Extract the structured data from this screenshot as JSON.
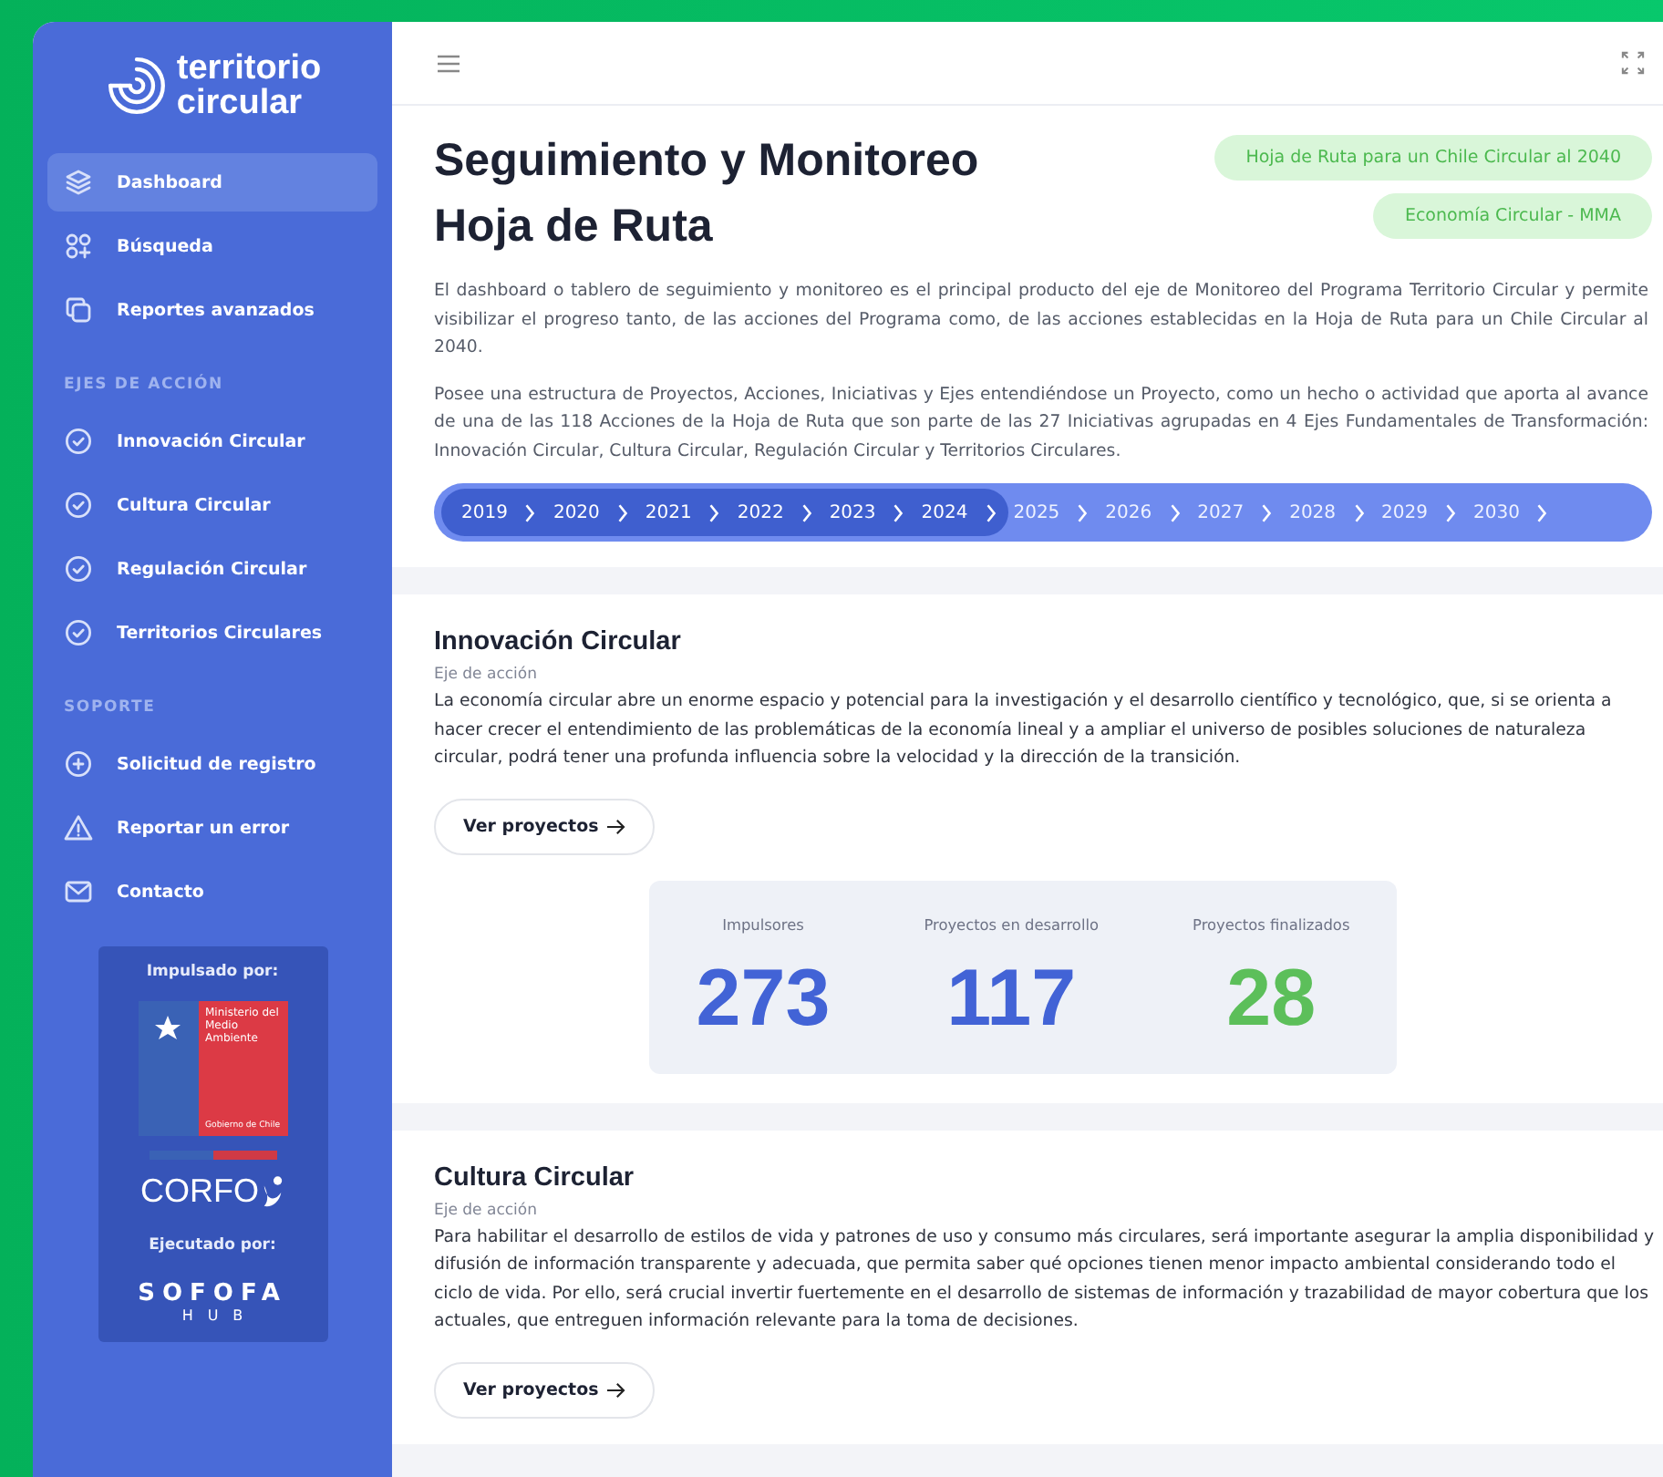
{
  "sidebar": {
    "logo": {
      "line1": "territorio",
      "line2": "circular"
    },
    "nav": [
      {
        "label": "Dashboard",
        "selected": true
      },
      {
        "label": "Búsqueda",
        "selected": false
      },
      {
        "label": "Reportes avanzados",
        "selected": false
      }
    ],
    "sections": [
      {
        "heading": "EJES DE ACCIÓN",
        "items": [
          {
            "label": "Innovación Circular"
          },
          {
            "label": "Cultura Circular"
          },
          {
            "label": "Regulación Circular"
          },
          {
            "label": "Territorios Circulares"
          }
        ]
      },
      {
        "heading": "SOPORTE",
        "items": [
          {
            "label": "Solicitud de registro"
          },
          {
            "label": "Reportar un error"
          },
          {
            "label": "Contacto"
          }
        ]
      }
    ],
    "sponsors": {
      "promoted_by": "Impulsado por:",
      "ministry": {
        "name": "Ministerio del Medio Ambiente",
        "government": "Gobierno de Chile"
      },
      "corfo": "CORFO",
      "executed_by": "Ejecutado por:",
      "sofofa": {
        "name": "SOFOFA",
        "sub": "HUB"
      }
    }
  },
  "header": {
    "title_lines": [
      "Seguimiento y Monitoreo",
      "Hoja de Ruta"
    ],
    "tags": [
      "Hoja de Ruta para un Chile Circular al 2040",
      "Economía Circular - MMA"
    ],
    "paragraphs": [
      "El dashboard o tablero de seguimiento y monitoreo es el principal producto del eje de Monitoreo del Programa Territorio Circular y permite visibilizar el progreso tanto, de las acciones del Programa como, de las acciones establecidas en la Hoja de Ruta para un Chile Circular al 2040.",
      "Posee una estructura de Proyectos, Acciones, Iniciativas y Ejes entendiéndose un Proyecto, como un hecho o actividad que aporta al avance de una de las 118 Acciones de la Hoja de Ruta que son parte de las 27 Iniciativas agrupadas en 4 Ejes Fundamentales de Transformación: Innovación Circular, Cultura Circular, Regulación Circular y Territorios Circulares."
    ],
    "timeline": [
      {
        "year": "2019",
        "selected": true
      },
      {
        "year": "2020",
        "selected": true
      },
      {
        "year": "2021",
        "selected": true
      },
      {
        "year": "2022",
        "selected": true
      },
      {
        "year": "2023",
        "selected": true
      },
      {
        "year": "2024",
        "selected": true
      },
      {
        "year": "2025",
        "selected": false
      },
      {
        "year": "2026",
        "selected": false
      },
      {
        "year": "2027",
        "selected": false
      },
      {
        "year": "2028",
        "selected": false
      },
      {
        "year": "2029",
        "selected": false
      },
      {
        "year": "2030",
        "selected": false
      }
    ]
  },
  "axes": [
    {
      "title": "Innovación Circular",
      "subtitle": "Eje de acción",
      "text": "La economía circular abre un enorme espacio y potencial para la investigación y el desarrollo científico y tecnológico, que, si se orienta a hacer crecer el entendimiento de las problemáticas de la economía lineal y a ampliar el universo de posibles soluciones de naturaleza circular, podrá tener una profunda influencia sobre la velocidad y la dirección de la transición.",
      "button": "Ver proyectos",
      "stats": [
        {
          "label": "Impulsores",
          "value": "273",
          "color": "#4263d6"
        },
        {
          "label": "Proyectos en desarrollo",
          "value": "117",
          "color": "#4263d6"
        },
        {
          "label": "Proyectos finalizados",
          "value": "28",
          "color": "#5cbf5a"
        }
      ]
    },
    {
      "title": "Cultura Circular",
      "subtitle": "Eje de acción",
      "text": "Para habilitar el desarrollo de estilos de vida y patrones de uso y consumo más circulares, será importante asegurar la amplia disponibilidad y difusión de información transparente y adecuada, que permita saber qué opciones tienen menor impacto ambiental considerando todo el ciclo de vida. Por ello, será crucial invertir fuertemente en el desarrollo de sistemas de información y trazabilidad de mayor cobertura que los actuales, que entreguen información relevante para la toma de decisiones.",
      "button": "Ver proyectos"
    }
  ]
}
